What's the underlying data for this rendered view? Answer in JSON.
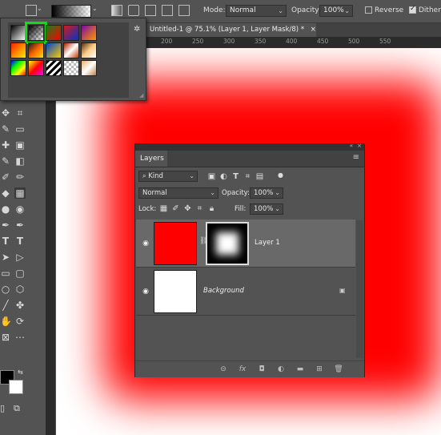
{
  "options_bar": {
    "mode_label": "Mode:",
    "mode_value": "Normal",
    "opacity_label": "Opacity:",
    "opacity_value": "100%",
    "reverse_label": "Reverse",
    "reverse_checked": false,
    "dither_label": "Dither",
    "dither_checked": true
  },
  "document_tab": {
    "title": "Untitled-1 @ 75.1% (Layer 1, Layer Mask/8) *",
    "close": "×"
  },
  "ruler_ticks": [
    "200",
    "250",
    "300",
    "350",
    "400",
    "450",
    "500",
    "550"
  ],
  "gradient_picker": {
    "selected_index": 1,
    "swatches": [
      "linear-gradient(135deg,#000,#fff)",
      "linear-gradient(135deg,#000 0%,rgba(0,0,0,0) 100%), repeating-conic-gradient(#bbb 0 25%,#fff 0 50%) 0 0/6px 6px",
      "linear-gradient(135deg,#1a7f1a,#ff0000)",
      "linear-gradient(135deg,#d41a1a,#0033cc)",
      "linear-gradient(135deg,#7a0aa0,#ff9900)",
      "linear-gradient(135deg,#ff2000,#ffee00)",
      "linear-gradient(135deg,#1a1a1a,#ff6600,#ffe000)",
      "linear-gradient(135deg,#0044cc,#ffcc00)",
      "linear-gradient(135deg,#aa2200,#ffffff,#cc3300)",
      "linear-gradient(135deg,#553311,#ffcc88,#ffffff)",
      "linear-gradient(135deg,#0000ff,#00ff00,#ffff00,#ff0000)",
      "linear-gradient(135deg,#ffff00,#ff0000,#ff00ff)",
      "repeating-linear-gradient(135deg,#000 0 3px,#fff 3px 6px)",
      "repeating-conic-gradient(#bbb 0 25%,#fff 0 50%) 0 0/6px 6px",
      "linear-gradient(135deg,#e8b070,#ffffff,#c08040)"
    ]
  },
  "layers_panel": {
    "tab_label": "Layers",
    "filter_kind": "Kind",
    "blend_mode": "Normal",
    "opacity_label": "Opacity:",
    "opacity_value": "100%",
    "lock_label": "Lock:",
    "fill_label": "Fill:",
    "fill_value": "100%",
    "layers": [
      {
        "name": "Layer 1",
        "active": true,
        "thumb_color": "#ff0000",
        "has_mask": true
      },
      {
        "name": "Background",
        "active": false,
        "thumb_color": "#ffffff",
        "locked": true
      }
    ]
  }
}
